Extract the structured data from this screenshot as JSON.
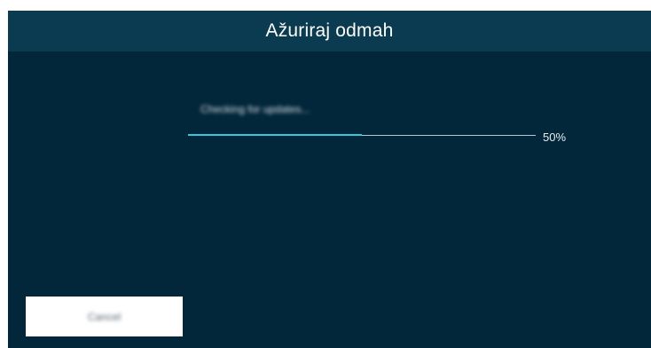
{
  "dialog": {
    "title": "Ažuriraj odmah",
    "status_text": "Checking for updates...",
    "progress": {
      "fraction": 0.5,
      "label": "50%",
      "fill_color": "#3ac7d8",
      "track_color": "#b8c7cf"
    },
    "cancel_button": {
      "label": "Cancel"
    }
  },
  "colors": {
    "background": "#02263a",
    "title_bar": "#0a3b51",
    "text": "#ffffff"
  }
}
